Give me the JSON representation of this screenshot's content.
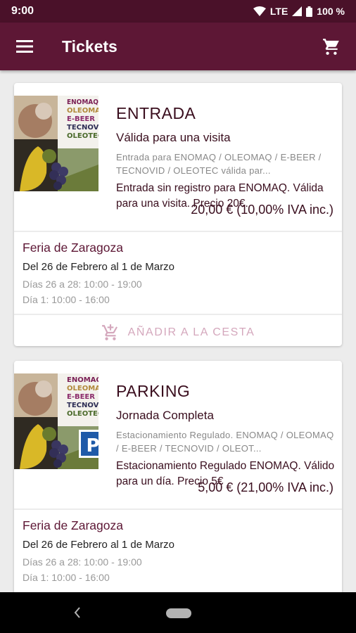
{
  "status_bar": {
    "time": "9:00",
    "network": "LTE",
    "battery": "100 %"
  },
  "app_bar": {
    "title": "Tickets",
    "menu_icon": "menu-icon",
    "cart_icon": "cart-icon"
  },
  "tickets": [
    {
      "name": "ENTRADA",
      "subtitle": "Válida para una visita",
      "small": "Entrada para ENOMAQ / OLEOMAQ / E-BEER / TECNOVID / OLEOTEC válida par...",
      "description": "Entrada sin registro para ENOMAQ. Válida para una visita. Precio 20€.",
      "price": "20,00 € (10,00% IVA inc.)",
      "thumb_lines": [
        "ENOMAQ",
        "OLEOMAQ",
        "E-BEER",
        "TECNOVID",
        "OLEOTEC"
      ],
      "event": {
        "title": "Feria de Zaragoza",
        "dates": "Del 26 de Febrero al 1 de Marzo",
        "line1": "Días 26 a 28: 10:00 - 19:00",
        "line2": "Día 1: 10:00 - 16:00"
      },
      "add_label": "AÑADIR A LA CESTA"
    },
    {
      "name": "PARKING",
      "subtitle": "Jornada Completa",
      "small": "Estacionamiento Regulado. ENOMAQ / OLEOMAQ / E-BEER / TECNOVID / OLEOT...",
      "description": "Estacionamiento Regulado ENOMAQ. Válido para un día. Precio 5€",
      "price": "5,00 € (21,00% IVA inc.)",
      "thumb_lines": [
        "ENOMAQ",
        "OLEOMAQ",
        "E-BEER",
        "TECNOVID",
        "OLEOTEC"
      ],
      "badge": "P",
      "event": {
        "title": "Feria de Zaragoza",
        "dates": "Del 26 de Febrero al 1 de Marzo",
        "line1": "Días 26 a 28:  10:00 - 19:00",
        "line2": "Día 1: 10:00 - 16:00"
      }
    }
  ],
  "colors": {
    "primary": "#5d1735",
    "status": "#4a1129",
    "accent_muted": "#d4a7bc"
  }
}
